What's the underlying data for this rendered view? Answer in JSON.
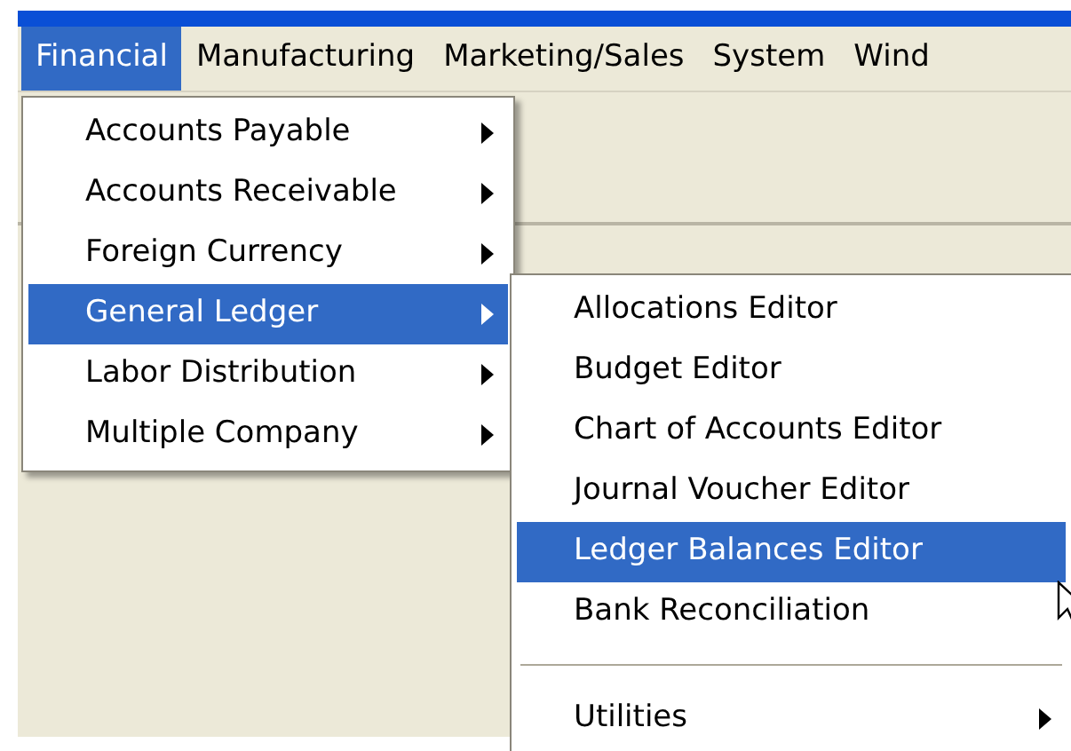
{
  "menu_bar": [
    {
      "label": "Financial",
      "selected": true
    },
    {
      "label": "Manufacturing",
      "selected": false
    },
    {
      "label": "Marketing/Sales",
      "selected": false
    },
    {
      "label": "System",
      "selected": false
    },
    {
      "label": "Wind",
      "selected": false
    }
  ],
  "dropdown": {
    "items": [
      {
        "label": "Accounts Payable",
        "kind": "submenu",
        "selected": false
      },
      {
        "label": "Accounts Receivable",
        "kind": "submenu",
        "selected": false
      },
      {
        "label": "Foreign Currency",
        "kind": "submenu",
        "selected": false
      },
      {
        "label": "General Ledger",
        "kind": "submenu",
        "selected": true
      },
      {
        "label": "Labor Distribution",
        "kind": "submenu",
        "selected": false
      },
      {
        "label": "Multiple Company",
        "kind": "submenu",
        "selected": false
      }
    ]
  },
  "submenu": {
    "items": [
      {
        "label": "Allocations Editor",
        "kind": "item",
        "selected": false
      },
      {
        "label": "Budget Editor",
        "kind": "item",
        "selected": false
      },
      {
        "label": "Chart of Accounts Editor",
        "kind": "item",
        "selected": false
      },
      {
        "label": "Journal Voucher Editor",
        "kind": "item",
        "selected": false
      },
      {
        "label": "Ledger Balances Editor",
        "kind": "item",
        "selected": true
      },
      {
        "label": "Bank Reconciliation",
        "kind": "item",
        "selected": false
      },
      {
        "kind": "separator"
      },
      {
        "label": "Utilities",
        "kind": "submenu",
        "selected": false
      }
    ]
  }
}
